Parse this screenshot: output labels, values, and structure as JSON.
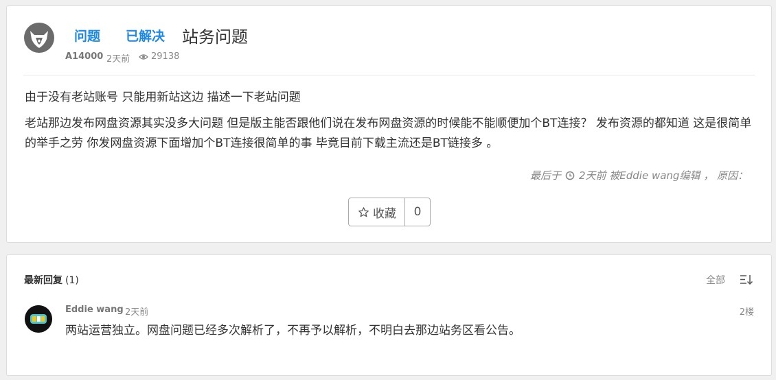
{
  "question": {
    "tags": [
      "问题",
      "已解决"
    ],
    "title": "站务问题",
    "author": "A14000",
    "time": "2天前",
    "views": "29138",
    "body_lines": [
      "由于没有老站账号  只能用新站这边 描述一下老站问题",
      "老站那边发布网盘资源其实没多大问题  但是版主能否跟他们说在发布网盘资源的时候能不能顺便加个BT连接？ 发布资源的都知道 这是很简单的举手之劳  你发网盘资源下面增加个BT连接很简单的事  毕竟目前下载主流还是BT链接多  。"
    ],
    "edit_prefix": "最后于",
    "edit_detail": "2天前 被Eddie wang编辑 ， 原因：",
    "favorite_label": "收藏",
    "favorite_count": "0"
  },
  "replies": {
    "header_label": "最新回复",
    "header_count": "(1)",
    "filter_label": "全部",
    "items": [
      {
        "author": "Eddie wang",
        "time": "2天前",
        "floor": "2楼",
        "text": "两站运营独立。网盘问题已经多次解析了，不再予以解析，不明白去那边站务区看公告。"
      }
    ]
  },
  "colors": {
    "accent": "#1e88e5",
    "background": "#f0f0f0",
    "card": "#ffffff",
    "muted_text": "#888888"
  },
  "icons": [
    "avatar-logo-icon",
    "eye-icon",
    "clock-icon",
    "star-icon",
    "sort-icon",
    "avatar-lgt-icon"
  ]
}
